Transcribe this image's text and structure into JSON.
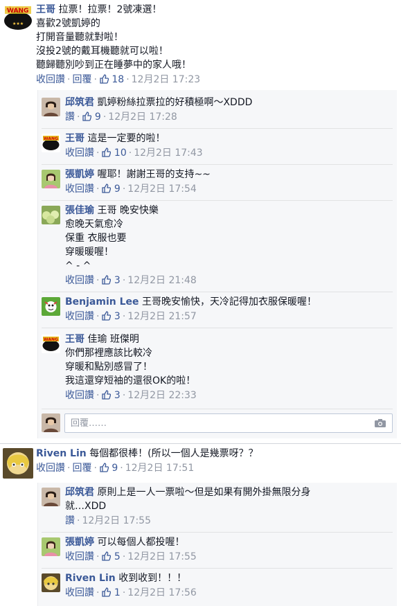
{
  "like_label": "讚",
  "unlike_label": "收回讚",
  "reply_label": "回覆",
  "reply_placeholder": "回覆……",
  "threads": [
    {
      "comment": {
        "name": "王哥",
        "lines": [
          "拉票！拉票！2號凍選！",
          "喜歡2號凱婷的",
          "打開音量聽就對啦！",
          "沒投2號的戴耳機聽就可以啦！",
          "聽歸聽別吵到正在睡夢中的家人哦！"
        ],
        "liked_by_me": true,
        "likes": "18",
        "date": "12月2日 17:23",
        "avatar": "wangge-logo"
      },
      "replies": [
        {
          "name": "邱筑君",
          "lines": [
            "凱婷粉絲拉票拉的好積極啊～XDDD"
          ],
          "liked_by_me": false,
          "likes": "9",
          "date": "12月2日 17:28",
          "avatar": "qiu-photo"
        },
        {
          "name": "王哥",
          "lines": [
            "這是一定要的啦！"
          ],
          "liked_by_me": true,
          "likes": "10",
          "date": "12月2日 17:43",
          "avatar": "wangge-logo"
        },
        {
          "name": "張凱婷",
          "lines": [
            "喔耶！謝謝王哥的支持~~"
          ],
          "liked_by_me": true,
          "likes": "9",
          "date": "12月2日 17:54",
          "avatar": "zhang-kaiting-photo"
        },
        {
          "name": "張佳瑜",
          "lines": [
            "王哥 晚安快樂",
            "愈晚天氣愈冷",
            "保重 衣服也要",
            "穿暖暖喔！",
            "^ - ^"
          ],
          "liked_by_me": true,
          "likes": "3",
          "date": "12月2日 21:48",
          "avatar": "zhang-jiayu-photo"
        },
        {
          "name": "Benjamin Lee",
          "lines": [
            "王哥晚安愉快，天冷記得加衣服保暖喔！"
          ],
          "liked_by_me": true,
          "likes": "3",
          "date": "12月2日 21:57",
          "avatar": "benjamin-photo"
        },
        {
          "name": "王哥",
          "lines": [
            "佳瑜 班傑明",
            "你們那裡應該比較冷",
            "穿暖和點別感冒了！",
            "我這還穿短袖的還很OK的啦！"
          ],
          "liked_by_me": true,
          "likes": "3",
          "date": "12月2日 22:33",
          "avatar": "wangge-logo"
        }
      ]
    },
    {
      "comment": {
        "name": "Riven Lin",
        "lines": [
          "每個都很棒！(所以一個人是幾票呀？？"
        ],
        "liked_by_me": true,
        "likes": "9",
        "date": "12月2日 17:51",
        "avatar": "riven-photo"
      },
      "replies": [
        {
          "name": "邱筑君",
          "lines": [
            "原則上是一人一票啦～但是如果有開外掛無限分身",
            "就…XDD"
          ],
          "liked_by_me": false,
          "likes": "",
          "date": "12月2日 17:55",
          "avatar": "qiu-photo"
        },
        {
          "name": "張凱婷",
          "lines": [
            "可以每個人都投喔！"
          ],
          "liked_by_me": true,
          "likes": "5",
          "date": "12月2日 17:55",
          "avatar": "zhang-kaiting-photo"
        },
        {
          "name": "Riven Lin",
          "lines": [
            "收到收到！！！"
          ],
          "liked_by_me": true,
          "likes": "1",
          "date": "12月2日 17:56",
          "avatar": "riven-photo"
        }
      ]
    }
  ],
  "colors": {
    "link": "#3b5998",
    "meta": "#9197a3",
    "reply_bg": "#f6f7f9"
  }
}
